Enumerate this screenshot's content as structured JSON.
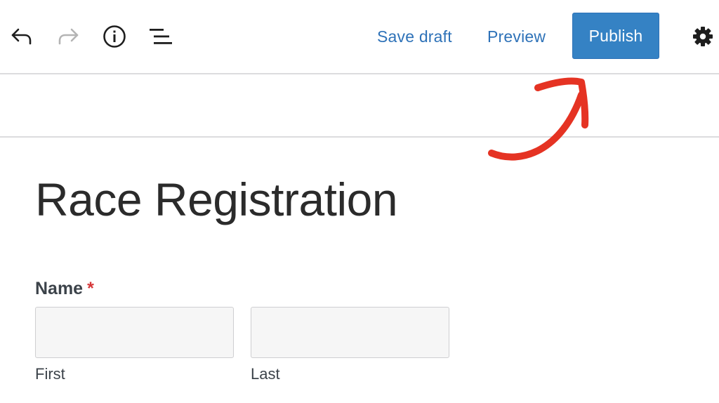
{
  "toolbar": {
    "undo_icon": "undo-icon",
    "redo_icon": "redo-icon",
    "info_icon": "info-icon",
    "outline_icon": "list-view-icon",
    "save_draft_label": "Save draft",
    "preview_label": "Preview",
    "publish_label": "Publish",
    "settings_icon": "gear-icon"
  },
  "annotation": {
    "arrow_color": "#e53323"
  },
  "colors": {
    "accent": "#2e72b8",
    "publish_bg": "#3582c4",
    "required": "#d63638"
  },
  "page": {
    "title": "Race Registration"
  },
  "form": {
    "name_field": {
      "label": "Name",
      "required_marker": "*",
      "first": {
        "value": "",
        "sublabel": "First"
      },
      "last": {
        "value": "",
        "sublabel": "Last"
      }
    }
  }
}
